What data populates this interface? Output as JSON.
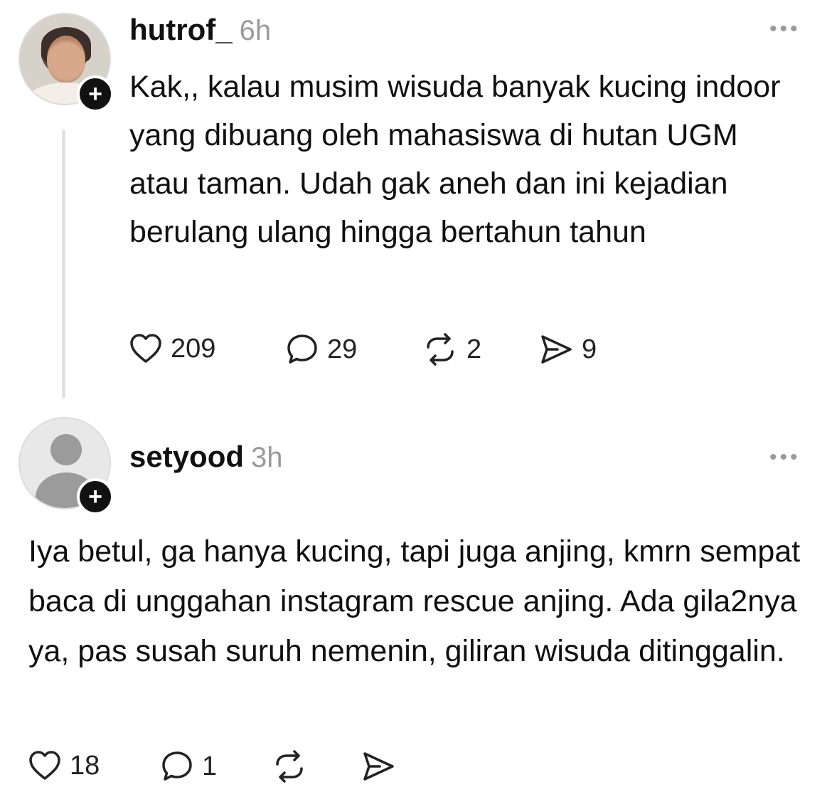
{
  "posts": [
    {
      "username": "hutrof_",
      "time": "6h",
      "more_label": "•••",
      "avatar": "user-photo-avatar",
      "follow_badge": "+",
      "text": "Kak,, kalau musim wisuda banyak kucing indoor yang dibuang oleh mahasiswa di hutan UGM atau taman. Udah gak aneh dan ini kejadian berulang ulang hingga bertahun tahun",
      "actions": {
        "likes": "209",
        "replies": "29",
        "reposts": "2",
        "shares": "9"
      }
    },
    {
      "username": "setyood",
      "time": "3h",
      "more_label": "•••",
      "avatar": "default-avatar",
      "follow_badge": "+",
      "text": "Iya betul, ga hanya kucing, tapi juga anjing, kmrn sempat baca di unggahan instagram rescue anjing. Ada gila2nya ya, pas susah suruh nemenin, giliran wisuda ditinggalin.",
      "actions": {
        "likes": "18",
        "replies": "1",
        "reposts": "",
        "shares": ""
      }
    }
  ],
  "icons": {
    "like": "heart-icon",
    "reply": "speech-bubble-icon",
    "repost": "repost-arrows-icon",
    "share": "send-icon",
    "more": "more-dots-icon",
    "follow": "plus-icon"
  },
  "colors": {
    "text": "#101010",
    "muted": "#9a9a9a",
    "badge": "#111111",
    "thread_line": "#e1e1e1"
  }
}
